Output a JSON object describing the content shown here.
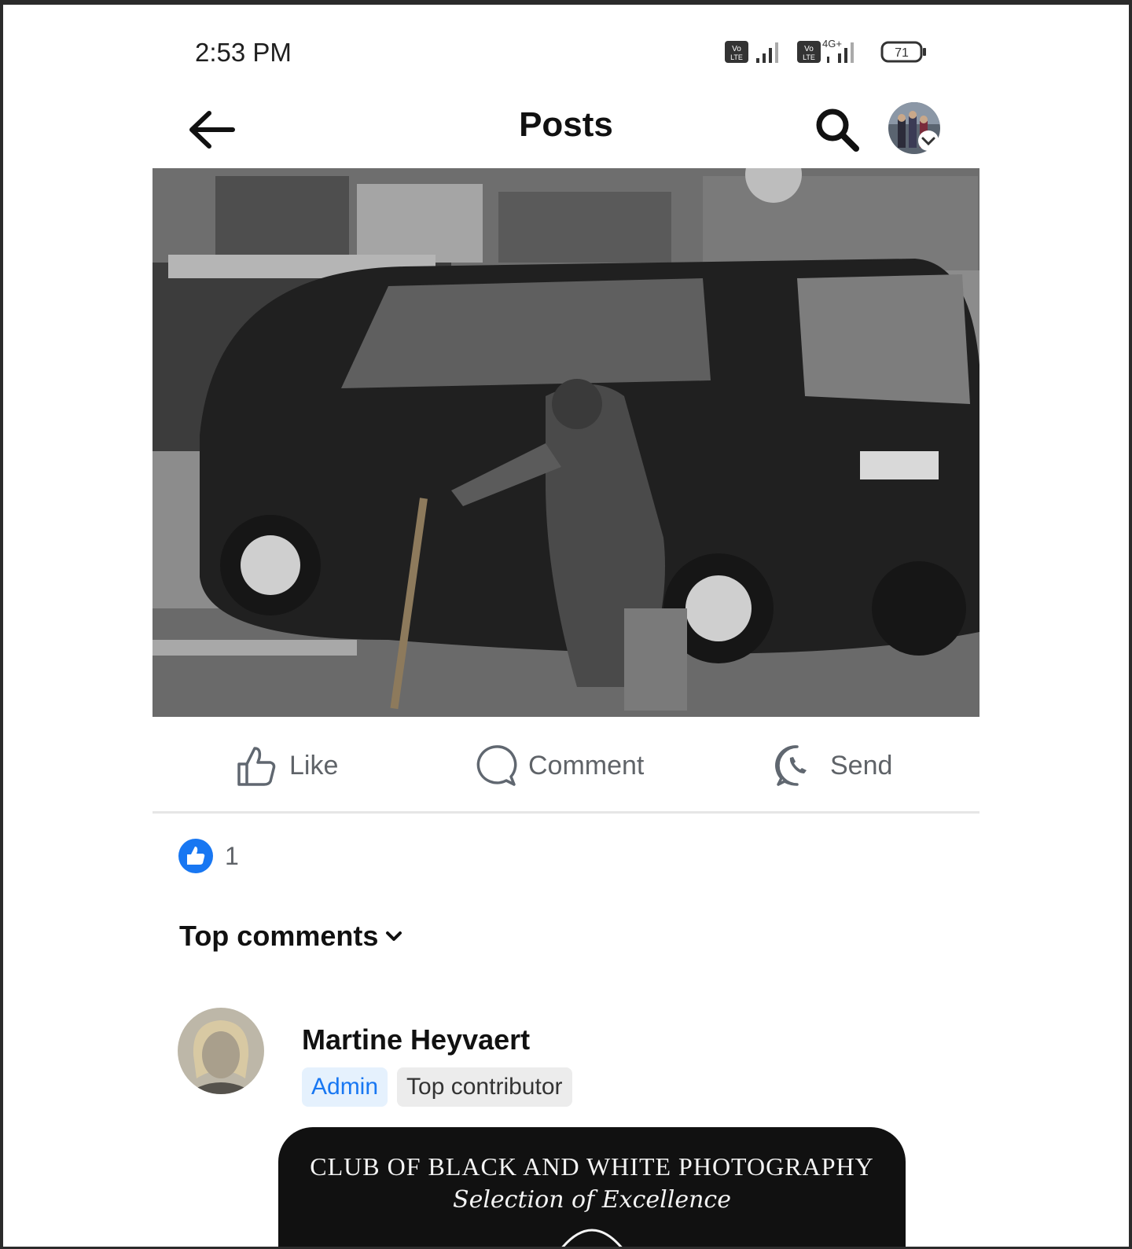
{
  "status_bar": {
    "time": "2:53 PM",
    "network_label": "4G+",
    "volte_label": "Vo LTE",
    "battery_level": "71"
  },
  "nav": {
    "title": "Posts"
  },
  "post": {
    "image_icon": "street-photo"
  },
  "actions": {
    "like_label": "Like",
    "comment_label": "Comment",
    "send_label": "Send"
  },
  "reactions": {
    "count": "1",
    "color": "#1877f2"
  },
  "comments": {
    "sort_label": "Top comments",
    "items": [
      {
        "author": "Martine Heyvaert",
        "badges": [
          "Admin",
          "Top contributor"
        ],
        "card_title": "CLUB OF BLACK AND WHITE PHOTOGRAPHY",
        "card_subtitle": "Selection of Excellence"
      }
    ]
  }
}
